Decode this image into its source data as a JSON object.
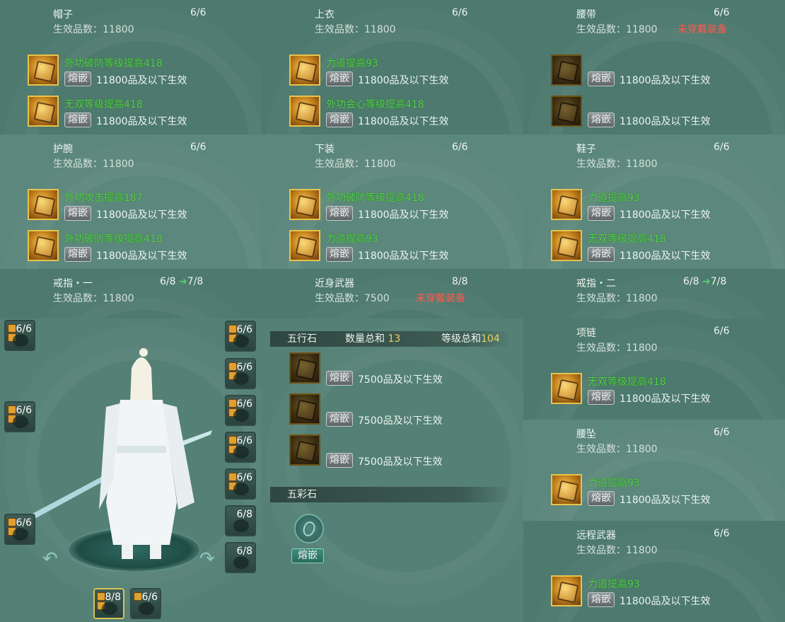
{
  "common": {
    "inlay": "熔嵌",
    "grade_label": "生效品数："
  },
  "equip": {
    "hat": {
      "name": "帽子",
      "count": "6/6",
      "grade": "11800",
      "gems": [
        {
          "attr": "外功破防等级提高418",
          "eff": "11800品及以下生效"
        },
        {
          "attr": "无双等级提高418",
          "eff": "11800品及以下生效"
        }
      ]
    },
    "coat": {
      "name": "上衣",
      "count": "6/6",
      "grade": "11800",
      "gems": [
        {
          "attr": "力道提高93",
          "eff": "11800品及以下生效"
        },
        {
          "attr": "外功会心等级提高418",
          "eff": "11800品及以下生效"
        }
      ]
    },
    "belt": {
      "name": "腰带",
      "count": "6/6",
      "grade": "11800",
      "warn": "未穿戴装备",
      "gems": [
        {
          "attr": "",
          "eff": "11800品及以下生效"
        },
        {
          "attr": "",
          "eff": "11800品及以下生效"
        }
      ]
    },
    "wrist": {
      "name": "护腕",
      "count": "6/6",
      "grade": "11800",
      "gems": [
        {
          "attr": "外功攻击提高187",
          "eff": "11800品及以下生效"
        },
        {
          "attr": "外功破防等级提高418",
          "eff": "11800品及以下生效"
        }
      ]
    },
    "pants": {
      "name": "下装",
      "count": "6/6",
      "grade": "11800",
      "gems": [
        {
          "attr": "外功破防等级提高418",
          "eff": "11800品及以下生效"
        },
        {
          "attr": "力道提高93",
          "eff": "11800品及以下生效"
        }
      ]
    },
    "shoes": {
      "name": "鞋子",
      "count": "6/6",
      "grade": "11800",
      "gems": [
        {
          "attr": "力道提高93",
          "eff": "11800品及以下生效"
        },
        {
          "attr": "无双等级提高418",
          "eff": "11800品及以下生效"
        }
      ]
    },
    "ring1": {
      "name": "戒指・一",
      "count": "6/8",
      "next": "7/8",
      "grade": "11800"
    },
    "melee": {
      "name": "近身武器",
      "count": "8/8",
      "grade": "7500",
      "warn": "未穿戴装备"
    },
    "ring2": {
      "name": "戒指・二",
      "count": "6/8",
      "next": "7/8",
      "grade": "11800"
    },
    "necklace": {
      "name": "项链",
      "count": "6/6",
      "grade": "11800",
      "gems": [
        {
          "attr": "无双等级提高418",
          "eff": "11800品及以下生效"
        }
      ]
    },
    "pendant": {
      "name": "腰坠",
      "count": "6/6",
      "grade": "11800",
      "gems": [
        {
          "attr": "力道提高93",
          "eff": "11800品及以下生效"
        }
      ]
    },
    "ranged": {
      "name": "远程武器",
      "count": "6/6",
      "grade": "11800",
      "gems": [
        {
          "attr": "力道提高93",
          "eff": "11800品及以下生效"
        }
      ]
    }
  },
  "wuxing": {
    "title": "五行石",
    "qty_label": "数量总和",
    "qty": "13",
    "level_label": "等级总和",
    "level": "104",
    "gems": [
      {
        "eff": "7500品及以下生效"
      },
      {
        "eff": "7500品及以下生效"
      },
      {
        "eff": "7500品及以下生效"
      }
    ]
  },
  "wucai": {
    "title": "五彩石",
    "inlay": "熔嵌"
  },
  "slots": {
    "left": [
      "6/6",
      "6/6",
      "6/6"
    ],
    "right": [
      "6/6",
      "6/6",
      "6/6",
      "6/6",
      "6/6",
      "6/8",
      "6/8"
    ],
    "bottom": [
      "8/8",
      "6/6"
    ]
  },
  "colors": {
    "attr_green": "#52d84a",
    "warn_red": "#ff5a4e",
    "gold": "#f0d060"
  }
}
